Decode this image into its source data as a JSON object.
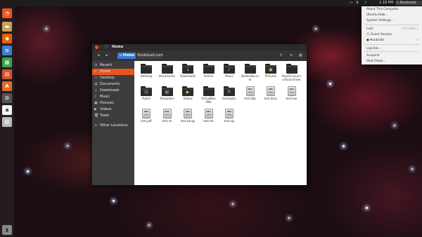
{
  "topbar": {
    "time": "1:18 PM",
    "username": "Noobslab"
  },
  "launcher": {
    "items": [
      {
        "name": "dash-icon",
        "glyph": "◔",
        "color": "#e95420"
      },
      {
        "name": "files-icon",
        "glyph": "▬",
        "color": "#c9a15b"
      },
      {
        "name": "firefox-icon",
        "glyph": "◉",
        "color": "#e66000"
      },
      {
        "name": "writer-icon",
        "glyph": "≡",
        "color": "#3e7fd0"
      },
      {
        "name": "calc-icon",
        "glyph": "▦",
        "color": "#3aa64a"
      },
      {
        "name": "impress-icon",
        "glyph": "▤",
        "color": "#d9532c"
      },
      {
        "name": "software-center-icon",
        "glyph": "A",
        "color": "#e36a2b"
      },
      {
        "name": "settings-icon",
        "glyph": "⚙",
        "color": "#555555"
      },
      {
        "name": "amazon-icon",
        "glyph": "a",
        "color": "#f4f4f4"
      },
      {
        "name": "workspaces-icon",
        "glyph": "▥",
        "color": "#bbbbbb"
      }
    ],
    "trash_glyph": "🗑"
  },
  "window": {
    "title": "Home",
    "path": {
      "home_label": "Home",
      "crumb": "NoobsLab.com"
    },
    "sidebar": [
      {
        "icon": "◷",
        "label": "Recent"
      },
      {
        "icon": "⌂",
        "label": "Home"
      },
      {
        "icon": "▭",
        "label": "Desktop"
      },
      {
        "icon": "▤",
        "label": "Documents"
      },
      {
        "icon": "↓",
        "label": "Downloads"
      },
      {
        "icon": "♪",
        "label": "Music"
      },
      {
        "icon": "▣",
        "label": "Pictures"
      },
      {
        "icon": "▶",
        "label": "Videos"
      },
      {
        "icon": "🗑",
        "label": "Trash"
      },
      {
        "icon": "+",
        "label": "Other Locations"
      }
    ],
    "files": [
      {
        "label": "Desktop",
        "type": "folder",
        "emblem": ""
      },
      {
        "label": "Documents",
        "type": "folder",
        "emblem": ""
      },
      {
        "label": "Downloads",
        "type": "folder",
        "emblem": "↓"
      },
      {
        "label": "Inmine",
        "type": "folder",
        "emblem": ""
      },
      {
        "label": "Music",
        "type": "folder",
        "emblem": "♪"
      },
      {
        "label": "Noobslab.com",
        "type": "folder",
        "emblem": ""
      },
      {
        "label": "Pictures",
        "type": "folder",
        "emblem": "▣"
      },
      {
        "label": "PlayOnLinux's virtual drives",
        "type": "folder",
        "emblem": ""
      },
      {
        "label": "Public",
        "type": "folder",
        "emblem": "☺"
      },
      {
        "label": "Templates",
        "type": "folder",
        "emblem": "▤"
      },
      {
        "label": "Videos",
        "type": "folder",
        "emblem": "▶"
      },
      {
        "label": "VirtualBox VMs",
        "type": "folder",
        "emblem": ""
      },
      {
        "label": "Examples",
        "type": "folder",
        "emblem": "⇱"
      },
      {
        "label": "test.deb",
        "type": "doc",
        "emblem": "ABC"
      },
      {
        "label": "test.docx",
        "type": "doc",
        "emblem": "ABC"
      },
      {
        "label": "test.exe",
        "type": "doc",
        "emblem": "ABC"
      },
      {
        "label": "test.pdf",
        "type": "doc",
        "emblem": "ABC"
      },
      {
        "label": "test.sh",
        "type": "doc",
        "emblem": "ABC"
      },
      {
        "label": "test.tar.gz",
        "type": "doc",
        "emblem": "ABC"
      },
      {
        "label": "test.txt",
        "type": "doc",
        "emblem": "ABC"
      },
      {
        "label": "test.zip",
        "type": "doc",
        "emblem": "ABC"
      }
    ]
  },
  "user_menu": {
    "items": [
      {
        "label": "About This Computer",
        "shortcut": ""
      },
      {
        "label": "Ubuntu Help...",
        "shortcut": ""
      },
      {
        "label": "System Settings...",
        "shortcut": ""
      },
      {
        "label": "Lock",
        "shortcut": "Ctrl+Alt+L"
      },
      {
        "label": "Guest Session",
        "shortcut": ""
      },
      {
        "label": "Noobslab",
        "shortcut": ""
      },
      {
        "label": "Log Out...",
        "shortcut": ""
      },
      {
        "label": "Suspend",
        "shortcut": ""
      },
      {
        "label": "Shut Down...",
        "shortcut": ""
      }
    ]
  }
}
